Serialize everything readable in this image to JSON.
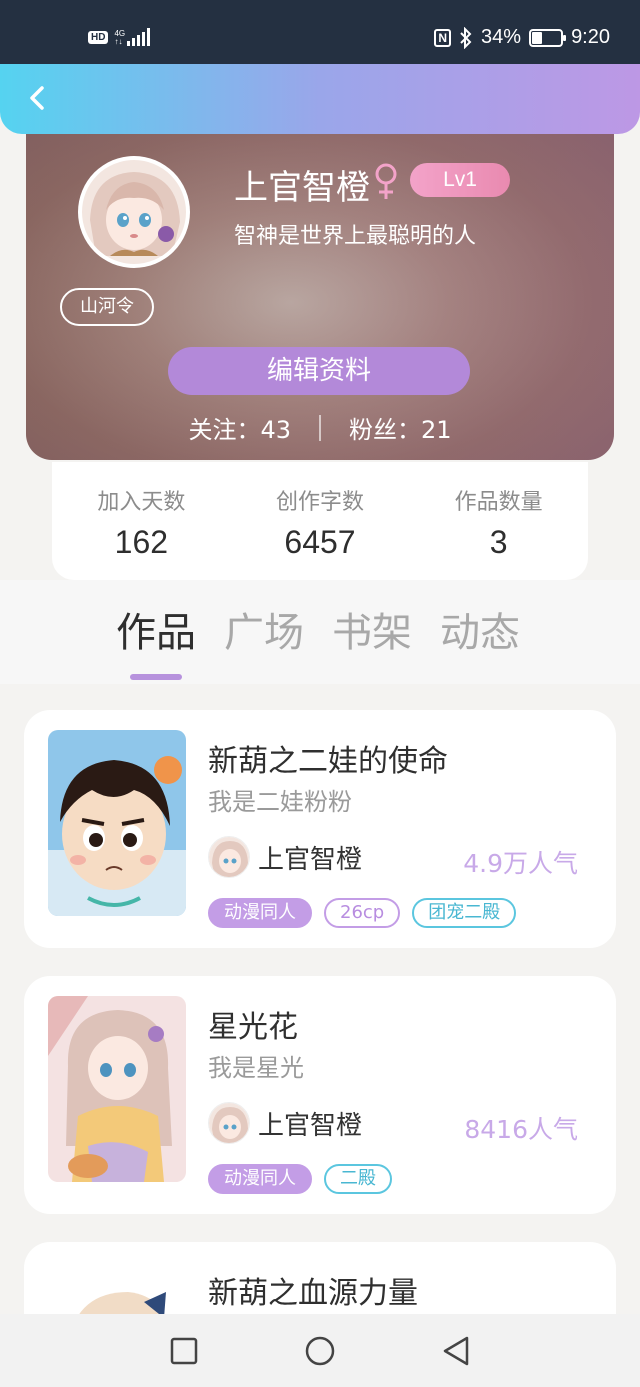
{
  "status_bar": {
    "hd": "HD",
    "network": "4G",
    "battery": "34%",
    "battery_level": 0.34,
    "time": "9:20"
  },
  "header": {
    "back_icon": "chevron-left-icon"
  },
  "profile": {
    "name": "上官智橙",
    "gender_icon": "female-icon",
    "level": "Lv1",
    "motto": "智神是世界上最聪明的人",
    "badge": "山河令",
    "edit_label": "编辑资料",
    "following_label": "关注：",
    "following": "43",
    "fans_label": "粉丝：",
    "fans": "21"
  },
  "stats": [
    {
      "label": "加入天数",
      "value": "162"
    },
    {
      "label": "创作字数",
      "value": "6457"
    },
    {
      "label": "作品数量",
      "value": "3"
    }
  ],
  "tabs": [
    {
      "label": "作品",
      "active": true
    },
    {
      "label": "广场",
      "active": false
    },
    {
      "label": "书架",
      "active": false
    },
    {
      "label": "动态",
      "active": false
    }
  ],
  "works": [
    {
      "title": "新葫之二娃的使命",
      "subtitle": "我是二娃粉粉",
      "author": "上官智橙",
      "popularity": "4.9万人气",
      "tags": [
        "动漫同人",
        "26cp",
        "团宠二殿"
      ]
    },
    {
      "title": "星光花",
      "subtitle": "我是星光",
      "author": "上官智橙",
      "popularity": "8416人气",
      "tags": [
        "动漫同人",
        "二殿"
      ]
    },
    {
      "title": "新葫之血源力量"
    }
  ],
  "nav": {
    "recent": "square-icon",
    "home": "circle-icon",
    "back": "triangle-back-icon"
  },
  "colors": {
    "accent": "#b389d9",
    "header_start": "#55d3f0",
    "header_end": "#bd98e5",
    "tag_cyan": "#5bc6df"
  }
}
